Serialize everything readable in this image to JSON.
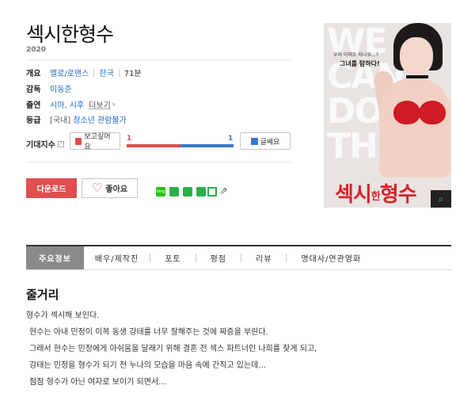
{
  "movie": {
    "title": "섹시한형수",
    "year": "2020"
  },
  "info": {
    "overview_label": "개요",
    "genre": "멜로/로맨스",
    "country": "한국",
    "runtime": "71분",
    "director_label": "감독",
    "director": "이동준",
    "cast_label": "출연",
    "cast": "시아, 시후",
    "more_label": "더보기",
    "rating_label": "등급",
    "rating_region": "[국내]",
    "rating": "청소년 관람불가"
  },
  "expect": {
    "label": "기대지수",
    "want_label": "보고싶어요",
    "nah_label": "글쎄요",
    "want_count": "1",
    "nah_count": "1",
    "want_ratio": 0.5,
    "colors": {
      "want": "#e04e4e",
      "nah": "#3a78c9"
    }
  },
  "actions": {
    "download_label": "다운로드",
    "like_label": "좋아요"
  },
  "share_icons": [
    "blog-icon",
    "share-green-icon",
    "share-green-icon-2",
    "book-icon",
    "square-icon",
    "export-icon"
  ],
  "poster": {
    "tagline_small": "우리 이래도 되나요...?",
    "tagline": "그녀를 탐하다!",
    "title_part1": "섹시",
    "title_mid": "한",
    "title_part2": "형수",
    "bg_text": "WE CAN DO THIS"
  },
  "tabs": [
    {
      "label": "주요정보",
      "active": true
    },
    {
      "label": "배우/제작진"
    },
    {
      "label": "포토"
    },
    {
      "label": "평점"
    },
    {
      "label": "리뷰"
    },
    {
      "label": "명대사/연관영화"
    }
  ],
  "plot": {
    "heading": "줄거리",
    "lines": [
      "형수가 섹시해 보인다.",
      "현수는 아내 민정이 이복 동생 강태를 너무 잘해주는 것에 짜증을 부린다.",
      "그래서 현수는 민정에게 아쉬움을 달래기 위해 결혼 전 섹스 파트너인 나희를 찾게 되고,",
      "강태는 민정을 형수가 되기 전 누나의 모습을 마음 속에 간직고 있는데...",
      "점점 형수가 아닌 여자로 보이기 되면서…"
    ]
  }
}
